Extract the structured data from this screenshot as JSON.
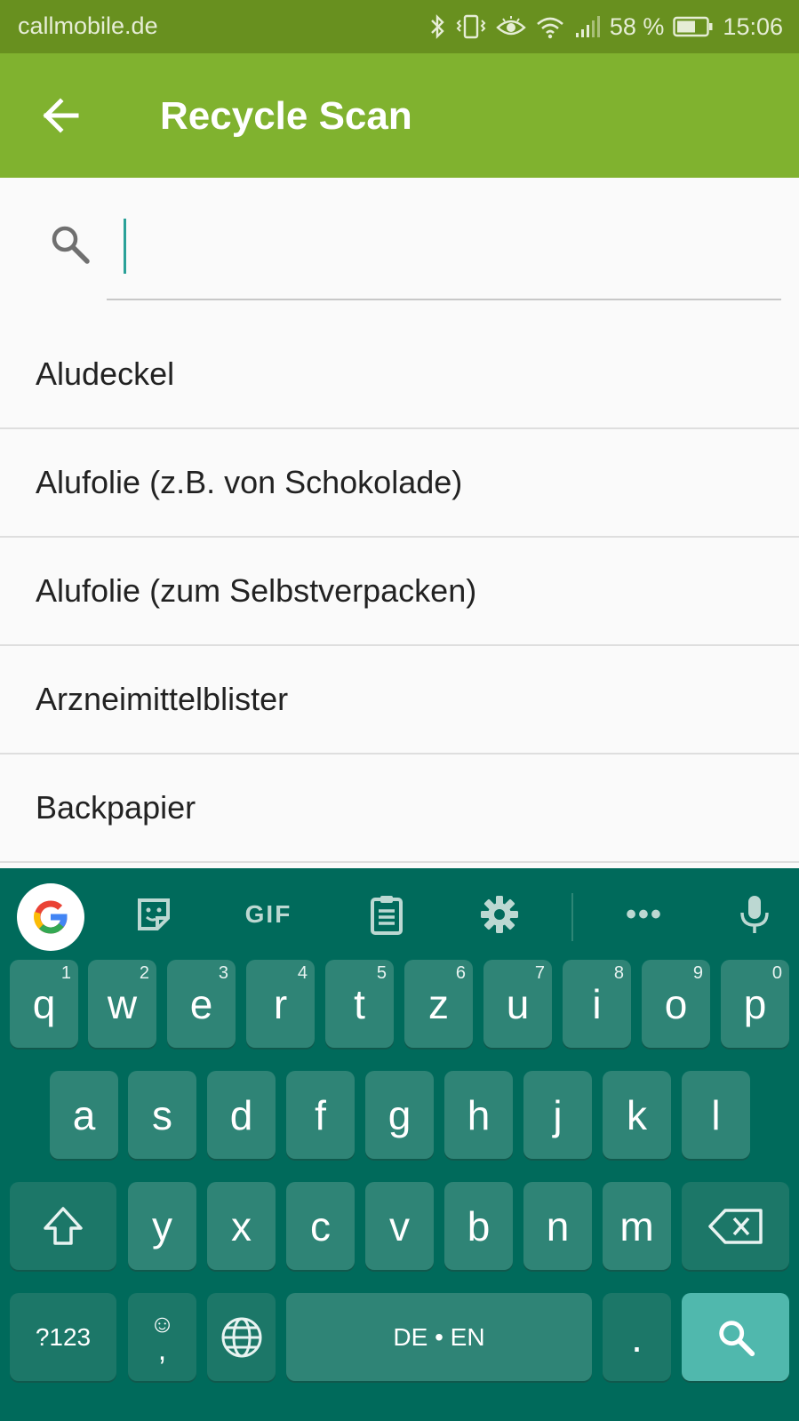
{
  "status_bar": {
    "carrier": "callmobile.de",
    "battery": "58 %",
    "time": "15:06"
  },
  "app_bar": {
    "title": "Recycle Scan"
  },
  "search": {
    "value": "",
    "placeholder": ""
  },
  "results": [
    {
      "label": "Aludeckel"
    },
    {
      "label": "Alufolie (z.B. von Schokolade)"
    },
    {
      "label": "Alufolie (zum Selbstverpacken)"
    },
    {
      "label": "Arzneimittelblister"
    },
    {
      "label": "Backpapier"
    }
  ],
  "keyboard": {
    "toolbar": {
      "gif_label": "GIF",
      "more_label": "•••"
    },
    "row1": [
      {
        "key": "q",
        "hint": "1"
      },
      {
        "key": "w",
        "hint": "2"
      },
      {
        "key": "e",
        "hint": "3"
      },
      {
        "key": "r",
        "hint": "4"
      },
      {
        "key": "t",
        "hint": "5"
      },
      {
        "key": "z",
        "hint": "6"
      },
      {
        "key": "u",
        "hint": "7"
      },
      {
        "key": "i",
        "hint": "8"
      },
      {
        "key": "o",
        "hint": "9"
      },
      {
        "key": "p",
        "hint": "0"
      }
    ],
    "row2": [
      "a",
      "s",
      "d",
      "f",
      "g",
      "h",
      "j",
      "k",
      "l"
    ],
    "row3": [
      "y",
      "x",
      "c",
      "v",
      "b",
      "n",
      "m"
    ],
    "symbols_label": "?123",
    "comma_label": ",",
    "emoji_label": "☺",
    "space_label": "DE • EN",
    "period_label": "."
  },
  "colors": {
    "status_bar": "#68901f",
    "app_bar": "#80b22f",
    "keyboard_bg": "#006a5b",
    "key_bg": "#2f8476",
    "cursor": "#2aa198"
  }
}
